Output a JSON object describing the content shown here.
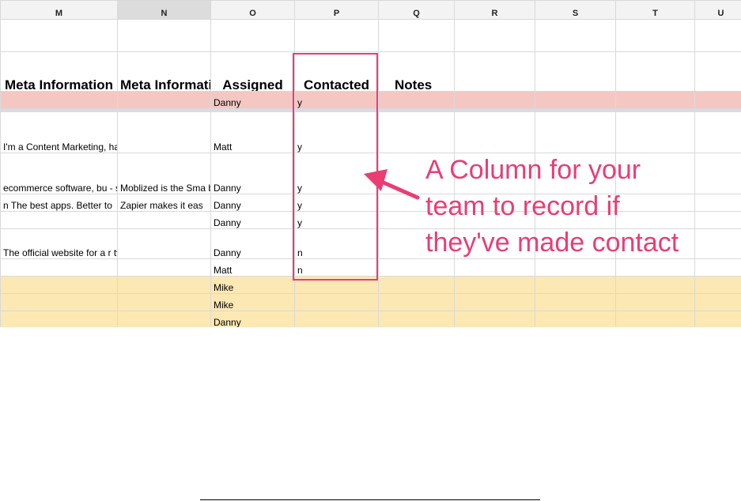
{
  "spreadsheet": {
    "columns": [
      "M",
      "N",
      "O",
      "P",
      "Q",
      "R",
      "S",
      "T",
      "U"
    ],
    "headers": {
      "meta_info_m": "Meta Information",
      "meta_info_n": "Meta Information",
      "assigned": "Assigned",
      "contacted": "Contacted",
      "notes": "Notes"
    },
    "rows": [
      {
        "m": "",
        "n": "",
        "assigned": "Danny",
        "contacted": "y"
      },
      {
        "m": "I'm a Content Marketing,\nhacker with a love for DI'\nl blog.",
        "n": "",
        "assigned": "Matt",
        "contacted": "y"
      },
      {
        "m": "ecommerce software, bu\n- software guides.",
        "n": "Moblized is the Sma\nbuilt to make your s\nprofitable.",
        "assigned": "Danny",
        "contacted": "y"
      },
      {
        "m": "n The best apps. Better to",
        "n": "Zapier makes it eas",
        "assigned": "Danny",
        "contacted": "y"
      },
      {
        "m": "",
        "n": "",
        "assigned": "Danny",
        "contacted": "y"
      },
      {
        "m": "The official website for a\nr tv programs, characters,",
        "n": "",
        "assigned": "Danny",
        "contacted": "n"
      },
      {
        "m": "",
        "n": "",
        "assigned": "Matt",
        "contacted": "n"
      },
      {
        "m": "",
        "n": "",
        "assigned": "Mike",
        "contacted": ""
      },
      {
        "m": "",
        "n": "",
        "assigned": "Mike",
        "contacted": ""
      },
      {
        "m": "",
        "n": "",
        "assigned": "Danny",
        "contacted": ""
      }
    ]
  },
  "annotation": {
    "text": "A Column for your\nteam to record if\nthey've made contact"
  },
  "colors": {
    "accent": "#ea3d74",
    "pink_row": "#f4c7c3",
    "yellow_row": "#fce8b2",
    "column_header_bg": "#f3f3f3",
    "selected_column_header_bg": "#dcdcdc"
  }
}
